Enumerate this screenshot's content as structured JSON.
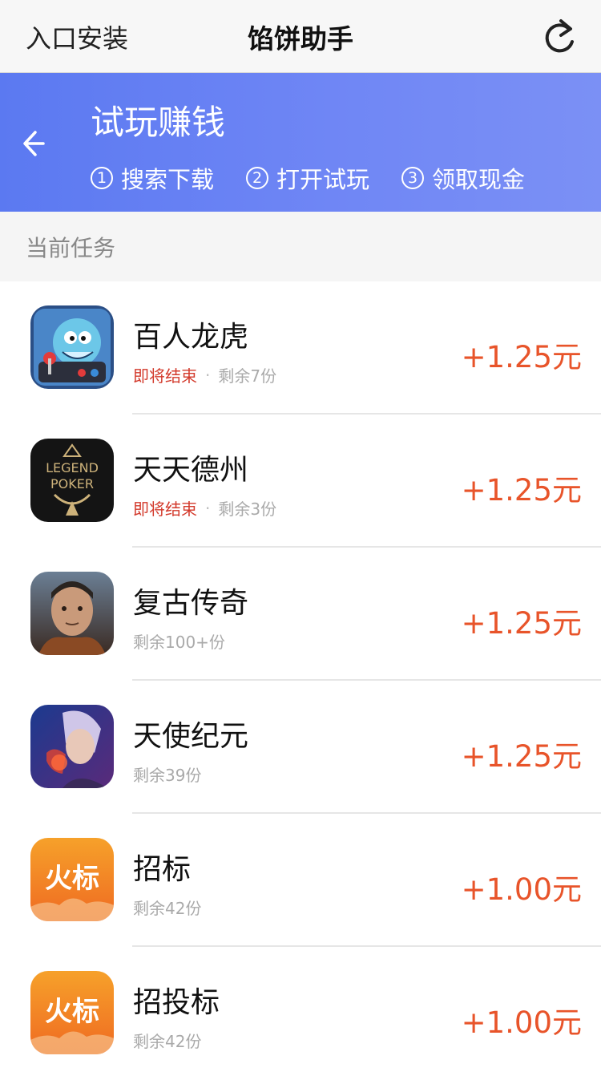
{
  "nav": {
    "left_label": "入口安装",
    "title": "馅饼助手",
    "refresh_icon": "refresh-icon"
  },
  "banner": {
    "title": "试玩赚钱",
    "steps": [
      {
        "num": "1",
        "label": "搜索下载"
      },
      {
        "num": "2",
        "label": "打开试玩"
      },
      {
        "num": "3",
        "label": "领取现金"
      }
    ],
    "gradient_start": "#5b79f1",
    "gradient_end": "#7b90f5"
  },
  "section": {
    "title": "当前任务"
  },
  "tasks": [
    {
      "name": "百人龙虎",
      "ending": "即将结束",
      "remaining": "剩余7份",
      "reward": "+1.25元"
    },
    {
      "name": "天天德州",
      "ending": "即将结束",
      "remaining": "剩余3份",
      "reward": "+1.25元"
    },
    {
      "name": "复古传奇",
      "ending": "",
      "remaining": "剩余100+份",
      "reward": "+1.25元"
    },
    {
      "name": "天使纪元",
      "ending": "",
      "remaining": "剩余39份",
      "reward": "+1.25元"
    },
    {
      "name": "招标",
      "ending": "",
      "remaining": "剩余42份",
      "reward": "+1.00元"
    },
    {
      "name": "招投标",
      "ending": "",
      "remaining": "剩余42份",
      "reward": "+1.00元"
    }
  ],
  "icons": {
    "legend_poker_line1": "LEGEND",
    "legend_poker_line2": "POKER",
    "huobiao_text": "火标"
  },
  "colors": {
    "reward": "#e8542a",
    "ending": "#d33a2c",
    "muted": "#aaaaaa"
  }
}
